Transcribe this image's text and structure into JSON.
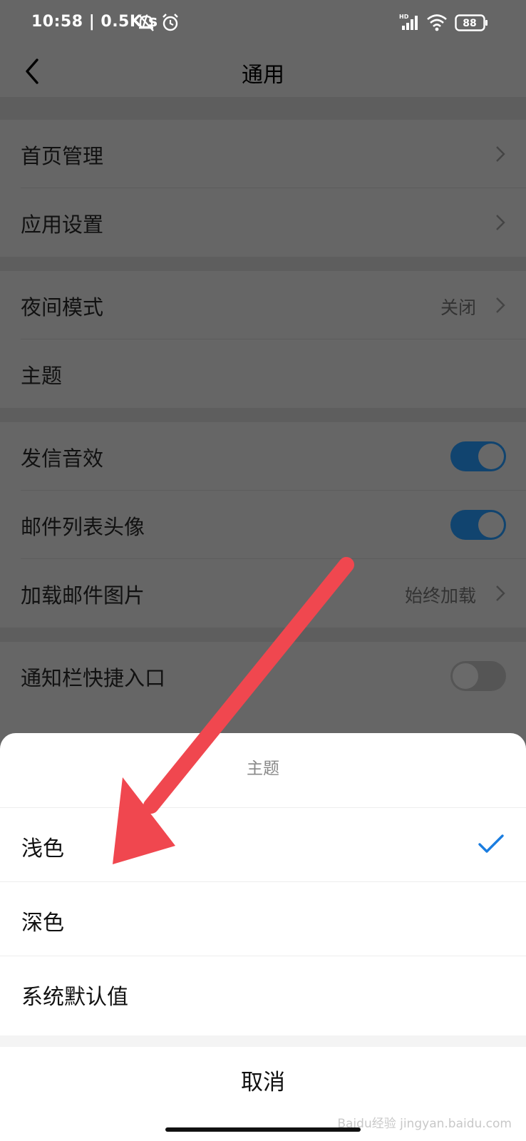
{
  "status_bar": {
    "time": "10:58 | 0.5K/s",
    "battery": "88"
  },
  "app_bar": {
    "title": "通用"
  },
  "settings": {
    "home_management": "首页管理",
    "app_settings": "应用设置",
    "night_mode": {
      "label": "夜间模式",
      "value": "关闭"
    },
    "theme": "主题",
    "send_sound": {
      "label": "发信音效",
      "on": true
    },
    "mail_list_avatar": {
      "label": "邮件列表头像",
      "on": true
    },
    "load_images": {
      "label": "加载邮件图片",
      "value": "始终加载"
    },
    "notification_shortcut": {
      "label": "通知栏快捷入口",
      "on": false
    }
  },
  "sheet": {
    "title": "主题",
    "options": [
      "浅色",
      "深色",
      "系统默认值"
    ],
    "selected_index": 0,
    "cancel": "取消"
  },
  "watermark": "Baidu经验 jingyan.baidu.com",
  "colors": {
    "accent": "#1a7de0",
    "arrow": "#f0474f",
    "overlay": "#666666"
  }
}
